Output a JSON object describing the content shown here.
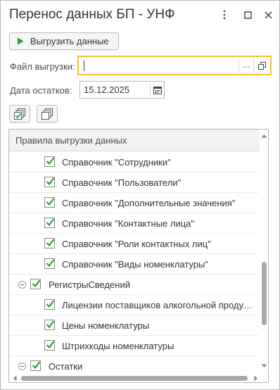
{
  "window": {
    "title": "Перенос данных БП - УНФ",
    "icons": {
      "more": "more-vertical-icon",
      "maximize": "maximize-icon",
      "close": "close-icon"
    }
  },
  "toolbar": {
    "export_label": "Выгрузить данные",
    "export_icon": "play-icon",
    "accent_color": "#2e9d3a"
  },
  "form": {
    "file_label": "Файл выгрузки:",
    "file_value": "",
    "file_choose_label": "...",
    "date_label": "Дата остатков:",
    "date_value": "15.12.2025",
    "focus_color": "#f2c238"
  },
  "tree_buttons": {
    "check_all_icon": "check-all-icon",
    "uncheck_all_icon": "uncheck-all-icon"
  },
  "tree": {
    "header": "Правила выгрузки данных",
    "rows": [
      {
        "label": "Справочник \"Сотрудники\"",
        "checked": true,
        "level": 1
      },
      {
        "label": "Справочник \"Пользователи\"",
        "checked": true,
        "level": 1
      },
      {
        "label": "Справочник \"Дополнительные значения\"",
        "checked": true,
        "level": 1
      },
      {
        "label": "Справочник \"Контактные лица\"",
        "checked": true,
        "level": 1
      },
      {
        "label": "Справочник \"Роли контактных лиц\"",
        "checked": true,
        "level": 1
      },
      {
        "label": "Справочник \"Виды номенклатуры\"",
        "checked": true,
        "level": 1
      },
      {
        "label": "РегистрыСведений",
        "checked": true,
        "level": 0,
        "group": true
      },
      {
        "label": "Лицензии поставщиков алкогольной продукции",
        "checked": true,
        "level": 1
      },
      {
        "label": "Цены номенклатуры",
        "checked": true,
        "level": 1
      },
      {
        "label": "Штрихкоды номенклатуры",
        "checked": true,
        "level": 1
      },
      {
        "label": "Остатки",
        "checked": true,
        "level": 0,
        "group": true
      }
    ]
  }
}
